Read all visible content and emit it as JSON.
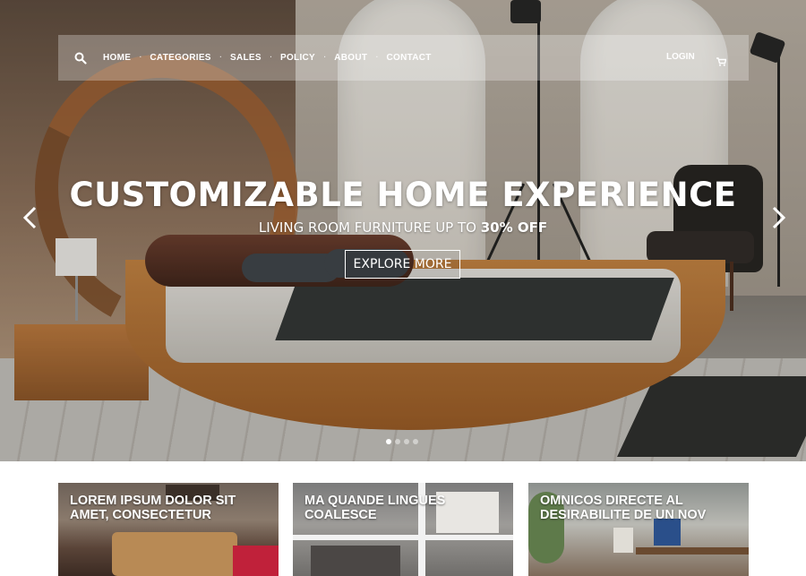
{
  "nav": {
    "items": [
      {
        "label": "HOME"
      },
      {
        "label": "CATEGORIES"
      },
      {
        "label": "SALES"
      },
      {
        "label": "POLICY"
      },
      {
        "label": "ABOUT"
      },
      {
        "label": "CONTACT"
      }
    ],
    "separator": "·",
    "login_label": "LOGIN",
    "icons": {
      "search": "search-icon",
      "cart": "cart-icon"
    }
  },
  "hero": {
    "title": "CUSTOMIZABLE HOME EXPERIENCE",
    "subtitle_prefix": "LIVING ROOM FURNITURE UP TO ",
    "subtitle_highlight": "30% OFF",
    "cta_label": "EXPLORE MORE",
    "slides_total": 4,
    "slide_active": 1,
    "icons": {
      "prev": "chevron-left-icon",
      "next": "chevron-right-icon"
    }
  },
  "cards": [
    {
      "title": "LOREM IPSUM DOLOR SIT AMET, CONSECTETUR"
    },
    {
      "title": "MA QUANDE LINGUES COALESCE"
    },
    {
      "title": "OMNICOS DIRECTE AL DESIRABILITE DE UN NOV"
    }
  ],
  "colors": {
    "text_on_image": "#ffffff",
    "page_bg": "#ffffff"
  }
}
